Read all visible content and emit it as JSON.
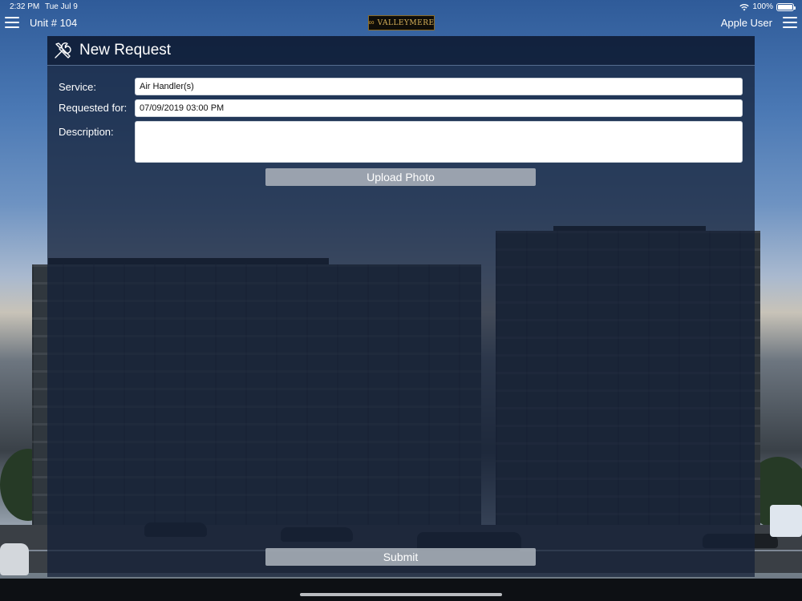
{
  "status_bar": {
    "time": "2:32 PM",
    "date": "Tue Jul 9",
    "battery": "100%"
  },
  "nav": {
    "unit": "Unit # 104",
    "user": "Apple User",
    "logo_text": "VALLEYMERE"
  },
  "panel": {
    "title": "New Request",
    "fields": {
      "service_label": "Service:",
      "service_value": "Air Handler(s)",
      "requested_label": "Requested for:",
      "requested_value": "07/09/2019 03:00 PM",
      "description_label": "Description:",
      "description_value": ""
    },
    "upload_label": "Upload Photo",
    "submit_label": "Submit"
  },
  "colors": {
    "panel_bg": "#14203a",
    "button_bg": "#aab0ba",
    "logo_gold": "#d8b25a"
  },
  "icons": [
    "hamburger-menu-icon",
    "tools-icon",
    "wifi-icon",
    "battery-icon"
  ]
}
